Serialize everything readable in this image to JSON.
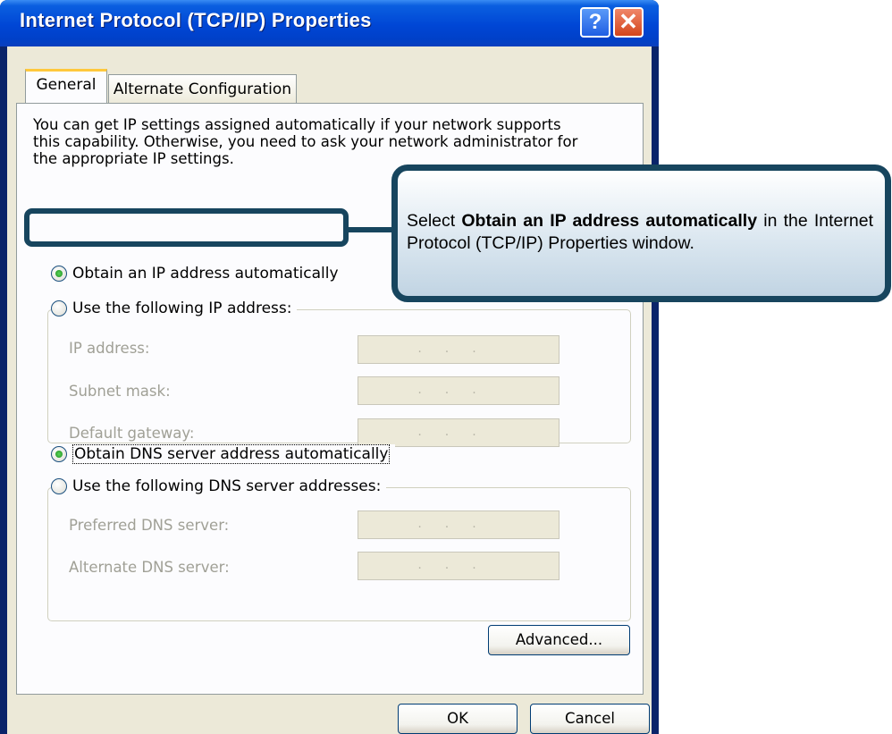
{
  "window": {
    "title": "Internet Protocol (TCP/IP) Properties",
    "help_label": "?",
    "close_label": "✕"
  },
  "tabs": [
    {
      "label": "General",
      "selected": true
    },
    {
      "label": "Alternate Configuration",
      "selected": false
    }
  ],
  "intro": "You can get IP settings assigned automatically if your network supports\nthis capability. Otherwise, you need to ask your network administrator for\nthe appropriate IP settings.",
  "ip": {
    "auto_label": "Obtain an IP address automatically",
    "auto_checked": true,
    "manual_label": "Use the following IP address:",
    "manual_checked": false,
    "fields": [
      {
        "label": "IP address:",
        "value": "..."
      },
      {
        "label": "Subnet mask:",
        "value": "..."
      },
      {
        "label": "Default gateway:",
        "value": "..."
      }
    ]
  },
  "dns": {
    "auto_label": "Obtain DNS server address automatically",
    "auto_checked": true,
    "manual_label": "Use the following DNS server addresses:",
    "manual_checked": false,
    "fields": [
      {
        "label": "Preferred DNS server:",
        "value": "..."
      },
      {
        "label": "Alternate DNS server:",
        "value": "..."
      }
    ]
  },
  "buttons": {
    "advanced": "Advanced...",
    "ok": "OK",
    "cancel": "Cancel"
  },
  "callout": {
    "prefix": "Select ",
    "emphasis": "Obtain an IP address automatically",
    "suffix": " in the Internet Protocol (TCP/IP) Properties window."
  },
  "colors": {
    "titlebar": "#0046d5",
    "dialog_face": "#ece9d8",
    "callout_border": "#17455e",
    "tab_highlight": "#ffc83c"
  }
}
